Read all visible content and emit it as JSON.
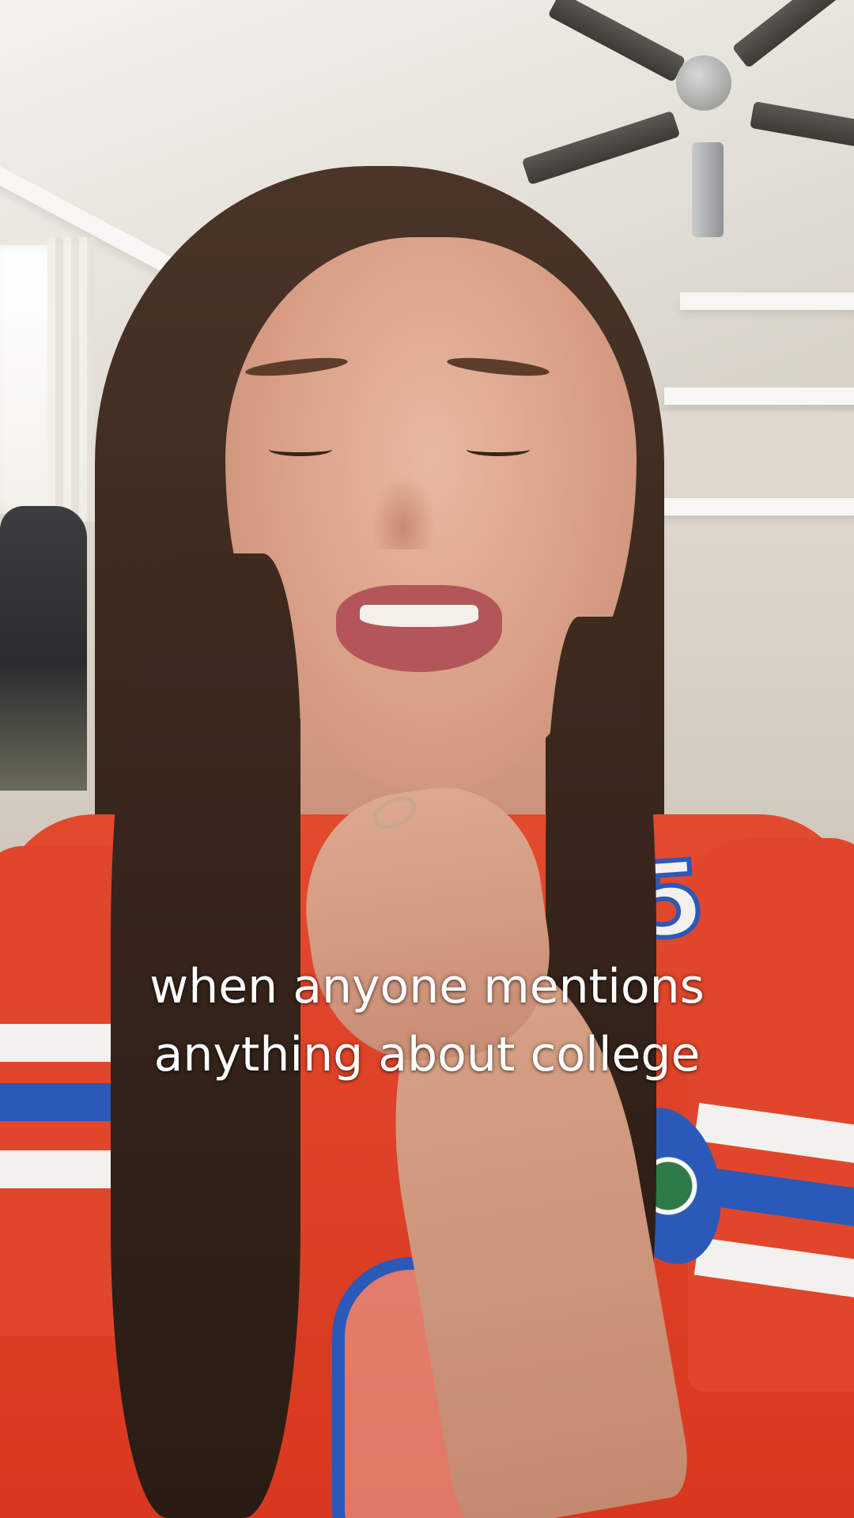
{
  "caption": {
    "line1": "when anyone mentions",
    "line2": "anything about college"
  },
  "jersey": {
    "shoulder_number": "5",
    "colors": {
      "primary": "#d8381f",
      "stripe_white": "#f3f1ee",
      "stripe_blue": "#2b59b8"
    }
  },
  "scene_colors": {
    "wall": "#ddd6cc",
    "hair": "#3a281d",
    "skin": "#d89f86"
  }
}
